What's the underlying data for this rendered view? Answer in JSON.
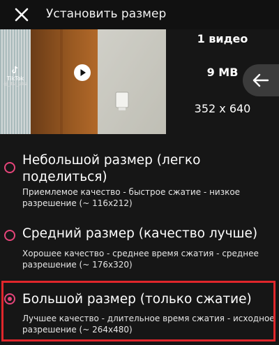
{
  "header": {
    "close_icon": "close-icon",
    "title": "Установить размер"
  },
  "preview": {
    "watermark_brand": "TikTok",
    "watermark_user": "@_itsr_pika",
    "play_icon": "play-icon"
  },
  "info": {
    "video_count": "1 видео",
    "file_size": "9 MB",
    "resolution": "352 x 640",
    "back_icon": "arrow-left-icon"
  },
  "options": [
    {
      "title_line1": "Небольшой размер (легко",
      "title_line2": "поделиться)",
      "desc_line1": "Приемлемое качество - быстрое сжатие - низкое",
      "desc_line2": "разрешение (~ 116x212)",
      "selected": false
    },
    {
      "title_line1": "Средний размер (качество лучше)",
      "desc_line1": "Хорошее качество - среднее время сжатия - среднее",
      "desc_line2": "разрешение (~ 176x320)",
      "selected": false
    },
    {
      "title_line1": "Большой размер (только сжатие)",
      "desc_line1": "Лучшее качество - длительное время сжатия - исходное",
      "desc_line2": "разрешение (~ 264x480)",
      "selected": true
    }
  ],
  "colors": {
    "accent": "#e6457a",
    "highlight": "#e0262b",
    "background": "#161616"
  }
}
